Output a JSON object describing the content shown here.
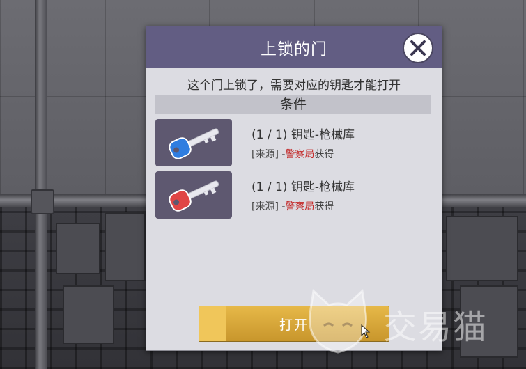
{
  "dialog": {
    "title": "上锁的门",
    "description": "这个门上锁了，需要对应的钥匙才能打开",
    "conditions_header": "条件",
    "items": [
      {
        "title": "(1 / 1) 钥匙-枪械库",
        "source_prefix": "[来源] -",
        "source_place": "警察局",
        "source_suffix": "获得",
        "key_color": "#2f7de0"
      },
      {
        "title": "(1 / 1) 钥匙-枪械库",
        "source_prefix": "[来源] -",
        "source_place": "警察局",
        "source_suffix": "获得",
        "key_color": "#e04545"
      }
    ],
    "open_button_label": "打开"
  },
  "watermark": {
    "text": "交易猫"
  },
  "colors": {
    "title_bar": "#625d83",
    "panel": "#dcdce2",
    "button": "#d4a83c",
    "source_place": "#c32727"
  }
}
